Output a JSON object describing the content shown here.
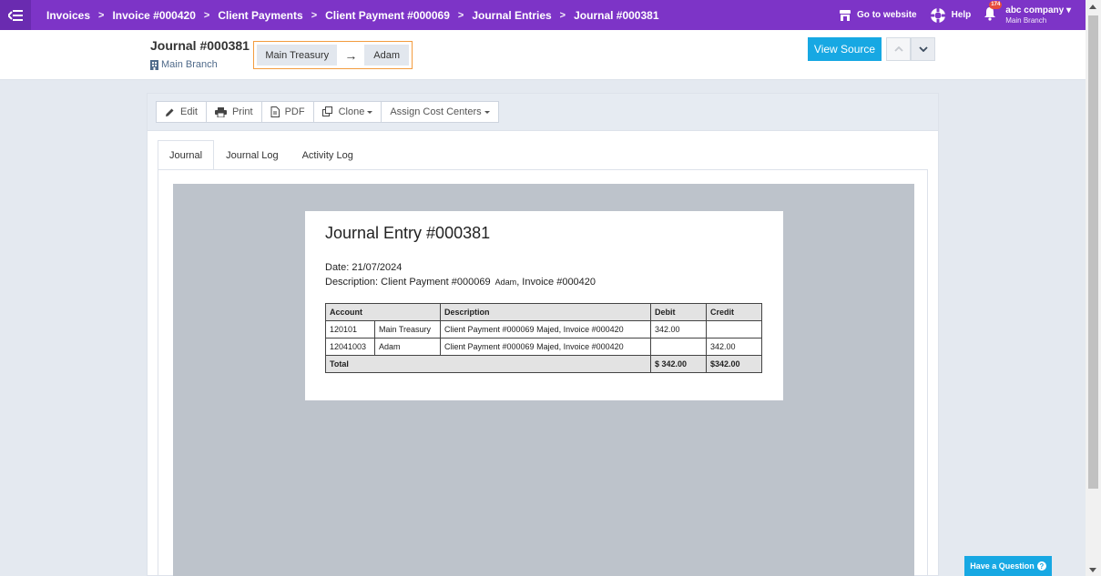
{
  "breadcrumbs": [
    "Invoices",
    "Invoice #000420",
    "Client Payments",
    "Client Payment #000069",
    "Journal Entries",
    "Journal #000381"
  ],
  "breadcrumb_separator": ">",
  "topbar": {
    "go_to_website": "Go to website",
    "help": "Help",
    "notification_count": "174",
    "company_name": "abc company",
    "company_branch": "Main Branch"
  },
  "header": {
    "title": "Journal #000381",
    "branch": "Main Branch",
    "flow_from": "Main Treasury",
    "flow_arrow": "→",
    "flow_to": "Adam",
    "view_source": "View Source"
  },
  "toolbar": {
    "edit": "Edit",
    "print": "Print",
    "pdf": "PDF",
    "clone": "Clone",
    "assign_cost_centers": "Assign Cost Centers"
  },
  "tabs": [
    {
      "label": "Journal",
      "active": true
    },
    {
      "label": "Journal Log",
      "active": false
    },
    {
      "label": "Activity Log",
      "active": false
    }
  ],
  "document": {
    "title": "Journal Entry #000381",
    "date": "Date: 21/07/2024",
    "description_main": "Description: Client Payment #000069",
    "description_small": "Adam",
    "description_tail": ", Invoice #000420",
    "columns": [
      "Account",
      "Description",
      "Debit",
      "Credit"
    ],
    "rows": [
      {
        "code": "120101",
        "account": "Main Treasury",
        "description": "Client Payment #000069 Majed, Invoice #000420",
        "debit": "342.00",
        "credit": ""
      },
      {
        "code": "12041003",
        "account": "Adam",
        "description": "Client Payment #000069 Majed, Invoice #000420",
        "debit": "",
        "credit": "342.00"
      }
    ],
    "total_label": "Total",
    "total_debit": "$ 342.00",
    "total_credit": "$342.00"
  },
  "have_question": "Have a Question",
  "colors": {
    "topbar": "#7d34c7",
    "accent": "#17a8e3",
    "flow_border": "#f39c3f"
  }
}
